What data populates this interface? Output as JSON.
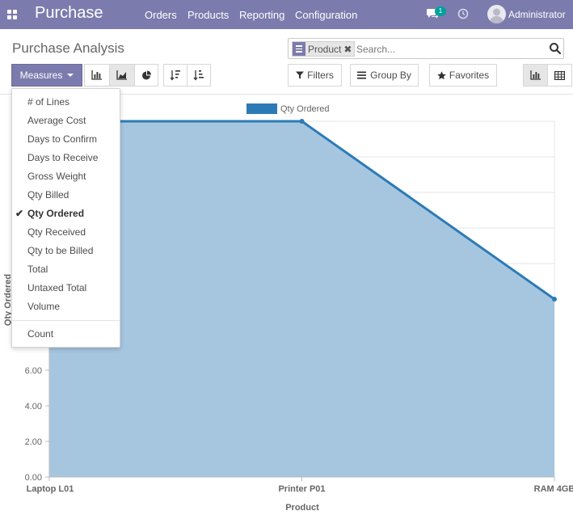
{
  "navbar": {
    "brand": "Purchase",
    "menus": [
      "Orders",
      "Products",
      "Reporting",
      "Configuration"
    ],
    "chat_badge": "1",
    "user_name": "Administrator",
    "icons": {
      "apps": "apps-grid-icon",
      "chat": "chat-icon",
      "activity": "clock-icon"
    }
  },
  "control_panel": {
    "title": "Purchase Analysis",
    "measures_label": "Measures",
    "search": {
      "facet_value": "Product",
      "placeholder": "Search..."
    },
    "filters_label": "Filters",
    "groupby_label": "Group By",
    "favorites_label": "Favorites"
  },
  "measures_menu": {
    "items": [
      {
        "label": "# of Lines",
        "selected": false
      },
      {
        "label": "Average Cost",
        "selected": false
      },
      {
        "label": "Days to Confirm",
        "selected": false
      },
      {
        "label": "Days to Receive",
        "selected": false
      },
      {
        "label": "Gross Weight",
        "selected": false
      },
      {
        "label": "Qty Billed",
        "selected": false
      },
      {
        "label": "Qty Ordered",
        "selected": true
      },
      {
        "label": "Qty Received",
        "selected": false
      },
      {
        "label": "Qty to be Billed",
        "selected": false
      },
      {
        "label": "Total",
        "selected": false
      },
      {
        "label": "Untaxed Total",
        "selected": false
      },
      {
        "label": "Volume",
        "selected": false
      }
    ],
    "count_label": "Count"
  },
  "chart_data": {
    "type": "area",
    "categories": [
      "Laptop L01",
      "Printer P01",
      "RAM 4GB"
    ],
    "series": [
      {
        "name": "Qty Ordered",
        "values": [
          20,
          20,
          10
        ]
      }
    ],
    "xlabel": "Product",
    "ylabel": "Qty Ordered",
    "ylim": [
      0,
      20
    ],
    "yticks": [
      "0.00",
      "2.00",
      "4.00",
      "6.00"
    ],
    "legend": "top",
    "grid": true,
    "colors": {
      "line": "#2c7bb6",
      "fill": "#a6c6e0"
    }
  }
}
